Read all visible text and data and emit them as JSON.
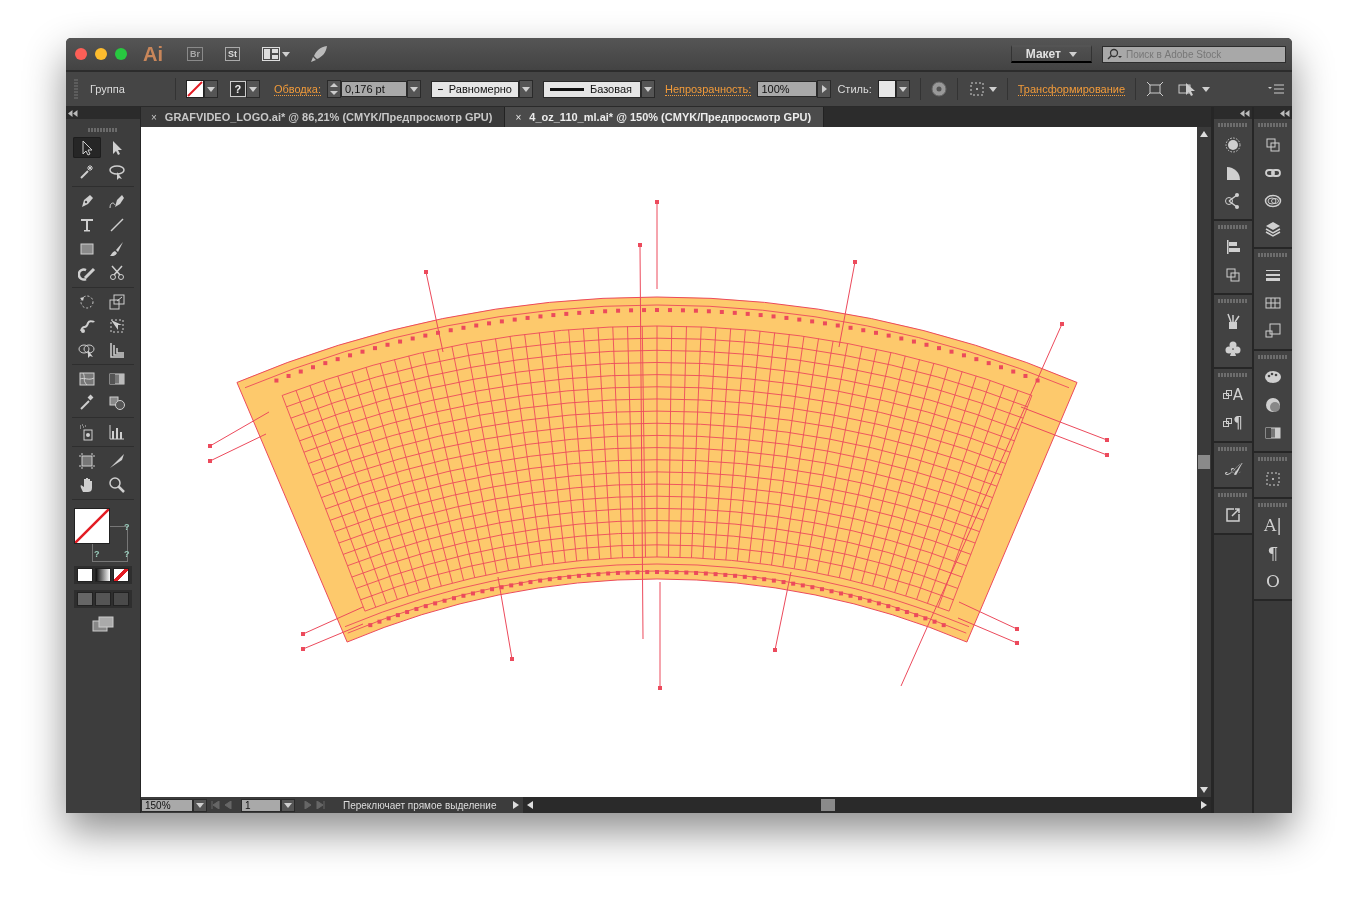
{
  "title_bar": {
    "app_logo": "Ai",
    "bridge": "Br",
    "stock": "St",
    "workspace": "Макет",
    "search": {
      "placeholder": "Поиск в Adobe Stock"
    }
  },
  "control_bar": {
    "selection": "Группа",
    "fill_mark": "?",
    "stroke_label": "Обводка:",
    "stroke_weight": "0,176 pt",
    "profile": "Равномерно",
    "brush": "Базовая",
    "opacity_label": "Непрозрачность:",
    "opacity": "100%",
    "style_label": "Стиль:",
    "transform_label": "Трансформирование"
  },
  "tabs": [
    {
      "close": "×",
      "label": "GRAFVIDEO_LOGO.ai* @ 86,21% (CMYK/Предпросмотр GPU)",
      "selected": false
    },
    {
      "close": "×",
      "label": "4_oz_110_ml.ai* @ 150% (CMYK/Предпросмотр GPU)",
      "selected": true
    }
  ],
  "tools": [
    [
      {
        "kind": "arrow-outline",
        "selected": true
      },
      {
        "kind": "arrow",
        "selected": false
      },
      {
        "kind": "wand",
        "selected": false
      },
      {
        "kind": "lasso",
        "selected": false
      }
    ],
    [
      {
        "kind": "pen",
        "selected": false
      },
      {
        "kind": "pen-curve",
        "selected": false
      },
      {
        "kind": "type",
        "selected": false
      },
      {
        "kind": "line",
        "selected": false
      },
      {
        "kind": "rectangle",
        "selected": false
      },
      {
        "kind": "brush",
        "selected": false
      },
      {
        "kind": "pencil",
        "selected": false
      },
      {
        "kind": "scissors",
        "selected": false
      }
    ],
    [
      {
        "kind": "rotate",
        "selected": false
      },
      {
        "kind": "scale",
        "selected": false
      },
      {
        "kind": "warp",
        "selected": false
      },
      {
        "kind": "free-transform",
        "selected": false
      },
      {
        "kind": "shape-builder",
        "selected": false
      },
      {
        "kind": "perspective-grid",
        "selected": false
      }
    ],
    [
      {
        "kind": "mesh",
        "selected": false
      },
      {
        "kind": "gradient",
        "selected": false
      },
      {
        "kind": "eyedropper",
        "selected": false
      },
      {
        "kind": "blend",
        "selected": false
      }
    ],
    [
      {
        "kind": "sprayer",
        "selected": false
      },
      {
        "kind": "bar-chart",
        "selected": false
      }
    ],
    [
      {
        "kind": "artboard",
        "selected": false
      },
      {
        "kind": "knife",
        "selected": false
      },
      {
        "kind": "hand",
        "selected": false
      },
      {
        "kind": "magnifier",
        "selected": false
      }
    ]
  ],
  "fill_stroke": {
    "marks": [
      "?",
      "?",
      "?"
    ]
  },
  "panels": [
    [
      [
        {
          "kind": "dotted-circle"
        },
        {
          "kind": "quarter-circle"
        },
        {
          "kind": "share-nodes"
        }
      ],
      [
        {
          "kind": "align-bars"
        },
        {
          "kind": "overlap-squares"
        }
      ],
      [
        {
          "kind": "brush-cup"
        },
        {
          "kind": "club"
        }
      ],
      [
        {
          "kind": "styled-glyph",
          "glyph": "A"
        },
        {
          "kind": "styled-glyph",
          "glyph": "¶"
        }
      ],
      [
        {
          "kind": "glyph",
          "glyph": "𝒜"
        }
      ],
      [
        {
          "kind": "external-arrow"
        }
      ]
    ],
    [
      [
        {
          "kind": "overlap-squares"
        },
        {
          "kind": "link-chain"
        },
        {
          "kind": "cloud"
        },
        {
          "kind": "layers-stack"
        }
      ],
      [
        {
          "kind": "stroke-lines"
        },
        {
          "kind": "grid"
        },
        {
          "kind": "artboard-squares"
        }
      ],
      [
        {
          "kind": "palette"
        },
        {
          "kind": "sphere"
        },
        {
          "kind": "gradient-square"
        }
      ],
      [
        {
          "kind": "dotted-box"
        }
      ],
      [
        {
          "kind": "glyph",
          "glyph": "A|"
        },
        {
          "kind": "glyph",
          "glyph": "¶"
        },
        {
          "kind": "glyph",
          "glyph": "O"
        }
      ]
    ]
  ],
  "status_bar": {
    "zoom": "150%",
    "page": "1",
    "message": "Переключает прямое выделение"
  }
}
